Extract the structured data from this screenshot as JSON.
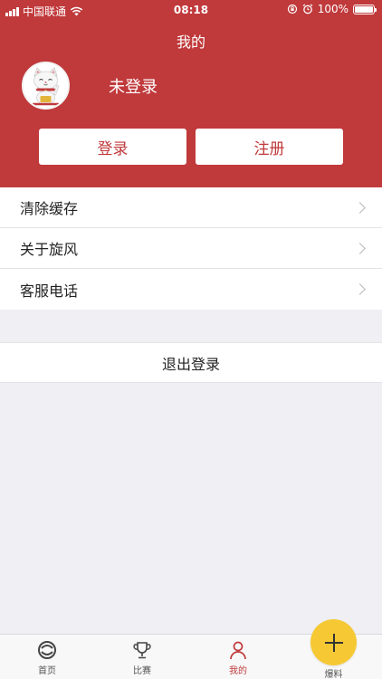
{
  "status_bar": {
    "carrier": "中国联通",
    "time": "08:18",
    "battery": "100%"
  },
  "header": {
    "title": "我的",
    "username": "未登录",
    "login_label": "登录",
    "register_label": "注册"
  },
  "menu": {
    "items": [
      {
        "label": "清除缓存"
      },
      {
        "label": "关于旋风"
      },
      {
        "label": "客服电话"
      }
    ]
  },
  "logout_label": "退出登录",
  "tabbar": {
    "home": "首页",
    "match": "比赛",
    "mine": "我的",
    "report": "爆料",
    "active": "mine"
  },
  "colors": {
    "brand": "#c0393b",
    "fab": "#f6c934",
    "background": "#efeff4"
  },
  "icons": [
    "signal-icon",
    "wifi-icon",
    "lock-rotation-icon",
    "alarm-icon",
    "battery-icon",
    "avatar-cat-icon",
    "chevron-right-icon",
    "home-icon",
    "trophy-icon",
    "person-icon",
    "plus-icon"
  ]
}
